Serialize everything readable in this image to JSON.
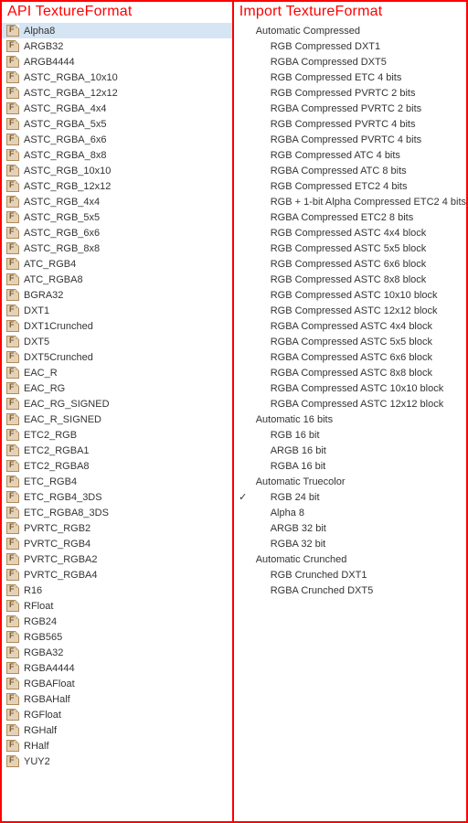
{
  "left": {
    "title": "API TextureFormat",
    "selected": 0,
    "items": [
      "Alpha8",
      "ARGB32",
      "ARGB4444",
      "ASTC_RGBA_10x10",
      "ASTC_RGBA_12x12",
      "ASTC_RGBA_4x4",
      "ASTC_RGBA_5x5",
      "ASTC_RGBA_6x6",
      "ASTC_RGBA_8x8",
      "ASTC_RGB_10x10",
      "ASTC_RGB_12x12",
      "ASTC_RGB_4x4",
      "ASTC_RGB_5x5",
      "ASTC_RGB_6x6",
      "ASTC_RGB_8x8",
      "ATC_RGB4",
      "ATC_RGBA8",
      "BGRA32",
      "DXT1",
      "DXT1Crunched",
      "DXT5",
      "DXT5Crunched",
      "EAC_R",
      "EAC_RG",
      "EAC_RG_SIGNED",
      "EAC_R_SIGNED",
      "ETC2_RGB",
      "ETC2_RGBA1",
      "ETC2_RGBA8",
      "ETC_RGB4",
      "ETC_RGB4_3DS",
      "ETC_RGBA8_3DS",
      "PVRTC_RGB2",
      "PVRTC_RGB4",
      "PVRTC_RGBA2",
      "PVRTC_RGBA4",
      "R16",
      "RFloat",
      "RGB24",
      "RGB565",
      "RGBA32",
      "RGBA4444",
      "RGBAFloat",
      "RGBAHalf",
      "RGFloat",
      "RGHalf",
      "RHalf",
      "YUY2"
    ]
  },
  "right": {
    "title": "Import TextureFormat",
    "checked": "RGB 24 bit",
    "highlighted": "RGBA Compressed ATC 8 bits",
    "groups": [
      {
        "label": "Automatic Compressed",
        "items": [
          "RGB Compressed DXT1",
          "RGBA Compressed DXT5",
          "RGB Compressed ETC 4 bits",
          "RGB Compressed PVRTC 2 bits",
          "RGBA Compressed PVRTC 2 bits",
          "RGB Compressed PVRTC 4 bits",
          "RGBA Compressed PVRTC 4 bits",
          "RGB Compressed ATC 4 bits",
          "RGBA Compressed ATC 8 bits",
          "RGB Compressed ETC2 4 bits",
          "RGB + 1-bit Alpha Compressed ETC2 4 bits",
          "RGBA Compressed ETC2 8 bits",
          "RGB Compressed ASTC 4x4 block",
          "RGB Compressed ASTC 5x5 block",
          "RGB Compressed ASTC 6x6 block",
          "RGB Compressed ASTC 8x8 block",
          "RGB Compressed ASTC 10x10 block",
          "RGB Compressed ASTC 12x12 block",
          "RGBA Compressed ASTC 4x4 block",
          "RGBA Compressed ASTC 5x5 block",
          "RGBA Compressed ASTC 6x6 block",
          "RGBA Compressed ASTC 8x8 block",
          "RGBA Compressed ASTC 10x10 block",
          "RGBA Compressed ASTC 12x12 block"
        ]
      },
      {
        "label": "Automatic 16 bits",
        "items": [
          "RGB 16 bit",
          "ARGB 16 bit",
          "RGBA 16 bit"
        ]
      },
      {
        "label": "Automatic Truecolor",
        "items": [
          "RGB 24 bit",
          "Alpha 8",
          "ARGB 32 bit",
          "RGBA 32 bit"
        ]
      },
      {
        "label": "Automatic Crunched",
        "items": [
          "RGB Crunched DXT1",
          "RGBA Crunched DXT5"
        ]
      }
    ]
  }
}
